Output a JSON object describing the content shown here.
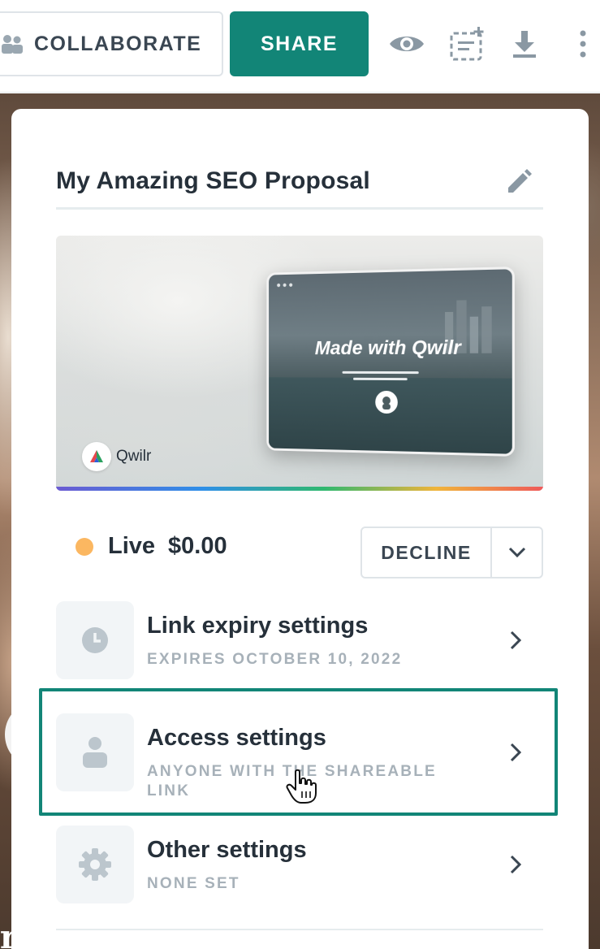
{
  "toolbar": {
    "collaborate_label": "COLLABORATE",
    "share_label": "SHARE",
    "icons": [
      "people-icon",
      "eye-icon",
      "add-section-icon",
      "download-icon",
      "more-vertical-icon"
    ]
  },
  "panel": {
    "title": "My Amazing SEO Proposal",
    "preview": {
      "mock_title": "Made with Qwilr",
      "brand_name": "Qwilr"
    },
    "status": {
      "label": "Live",
      "amount": "$0.00",
      "dot_color": "#fbb761"
    },
    "decline_label": "DECLINE",
    "settings": [
      {
        "title": "Link expiry settings",
        "subtitle": "EXPIRES OCTOBER 10, 2022",
        "icon": "clock-icon"
      },
      {
        "title": "Access settings",
        "subtitle": "ANYONE WITH THE SHAREABLE LINK",
        "icon": "person-icon"
      },
      {
        "title": "Other settings",
        "subtitle": "NONE SET",
        "icon": "gear-icon"
      }
    ]
  },
  "colors": {
    "accent": "#128577",
    "text": "#26303a",
    "muted": "#a7b1b9"
  }
}
